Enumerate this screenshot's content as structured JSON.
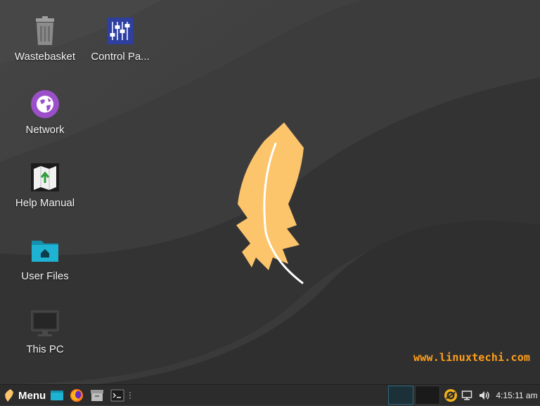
{
  "desktop": {
    "icons": [
      {
        "id": "wastebasket",
        "label": "Wastebasket"
      },
      {
        "id": "control-panel",
        "label": "Control Pa..."
      },
      {
        "id": "network",
        "label": "Network"
      },
      {
        "id": "help-manual",
        "label": "Help Manual"
      },
      {
        "id": "user-files",
        "label": "User Files"
      },
      {
        "id": "this-pc",
        "label": "This PC"
      }
    ],
    "watermark": "www.linuxtechi.com"
  },
  "taskbar": {
    "menu_label": "Menu",
    "launchers": [
      "file-manager-icon",
      "firefox-icon",
      "archive-icon",
      "terminal-icon"
    ],
    "clock": "4:15:11 am"
  },
  "colors": {
    "feather": "#fcc46b",
    "watermark": "#ff9f1a",
    "taskbar": "#2c2c2c",
    "network_purple": "#9b4fc9",
    "control_panel_blue": "#2e3f9e",
    "folder_cyan": "#1fb3d3"
  }
}
